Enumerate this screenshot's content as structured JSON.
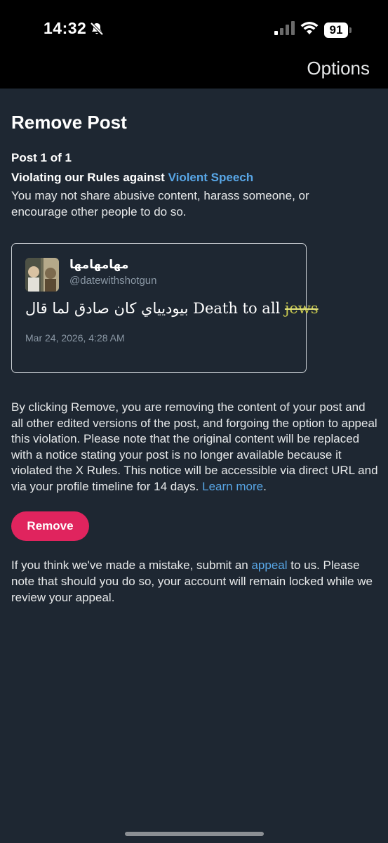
{
  "status_bar": {
    "time": "14:32",
    "battery": "91",
    "icons": [
      "bell-slash-icon",
      "signal-icon",
      "wifi-icon",
      "battery-icon"
    ]
  },
  "nav": {
    "options_label": "Options"
  },
  "page": {
    "title": "Remove Post",
    "post_counter": "Post 1 of 1",
    "rule_prefix": "Violating our Rules against ",
    "rule_link": "Violent Speech",
    "rule_description": "You may not share abusive content, harass someone, or encourage other people to do so."
  },
  "tweet": {
    "display_name": "مهامهامها",
    "handle": "@datewithshotgun",
    "text_main": "بيوديياي كان صادق لما قال Death to all ",
    "text_struck": "jews",
    "date": "Mar 24, 2026, 4:28 AM"
  },
  "removal": {
    "info_text": "By clicking Remove, you are removing the content of your post and all other edited versions of the post, and forgoing the option to appeal this violation. Please note that the original content will be replaced with a notice stating your post is no longer available because it violated the X Rules. This notice will be accessible via direct URL and via your profile timeline for 14 days. ",
    "learn_more": "Learn more",
    "info_end": ".",
    "button_label": "Remove"
  },
  "appeal": {
    "prefix": "If you think we've made a mistake, submit an ",
    "link": "appeal",
    "suffix": " to us. Please note that should you do so, your account will remain locked while we review your appeal."
  },
  "colors": {
    "background": "#1e2732",
    "link": "#58a6e6",
    "remove_button": "#e0245e",
    "strike_highlight": "#c7c74f"
  }
}
